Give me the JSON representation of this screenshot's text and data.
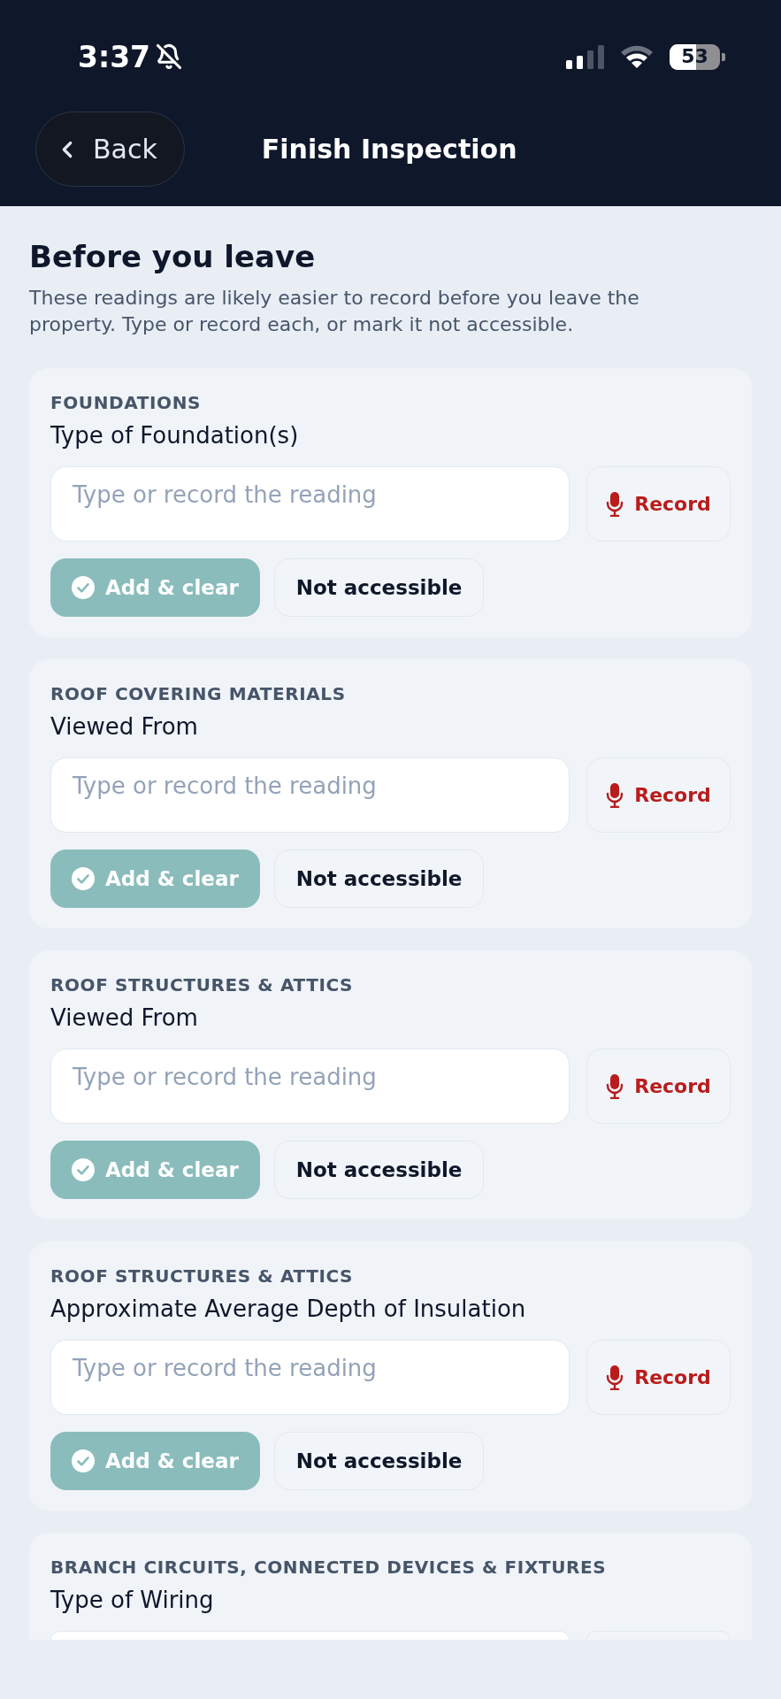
{
  "status_bar": {
    "time": "3:37",
    "battery": "53"
  },
  "nav": {
    "back_label": "Back",
    "title": "Finish Inspection"
  },
  "intro": {
    "heading": "Before you leave",
    "text": "These readings are likely easier to record before you leave the property. Type or record each, or mark it not accessible."
  },
  "readings": [
    {
      "category": "FOUNDATIONS",
      "title": "Type of Foundation(s)",
      "placeholder": "Type or record the reading",
      "record_label": "Record",
      "actions": [
        {
          "label": "Add & clear",
          "kind": "add",
          "disabled": true
        },
        {
          "label": "Not accessible",
          "kind": "skip"
        }
      ]
    },
    {
      "category": "ROOF COVERING MATERIALS",
      "title": "Viewed From",
      "placeholder": "Type or record the reading",
      "record_label": "Record",
      "actions": [
        {
          "label": "Add & clear",
          "kind": "add",
          "disabled": true
        },
        {
          "label": "Not accessible",
          "kind": "skip"
        }
      ]
    },
    {
      "category": "ROOF STRUCTURES & ATTICS",
      "title": "Viewed From",
      "placeholder": "Type or record the reading",
      "record_label": "Record",
      "actions": [
        {
          "label": "Add & clear",
          "kind": "add",
          "disabled": true
        },
        {
          "label": "Not accessible",
          "kind": "skip"
        }
      ]
    },
    {
      "category": "ROOF STRUCTURES & ATTICS",
      "title": "Approximate Average Depth of Insulation",
      "placeholder": "Type or record the reading",
      "record_label": "Record",
      "actions": [
        {
          "label": "Add & clear",
          "kind": "add",
          "disabled": true
        },
        {
          "label": "Not accessible",
          "kind": "skip"
        }
      ]
    },
    {
      "category": "BRANCH CIRCUITS, CONNECTED DEVICES & FIXTURES",
      "title": "Type of Wiring"
    }
  ]
}
